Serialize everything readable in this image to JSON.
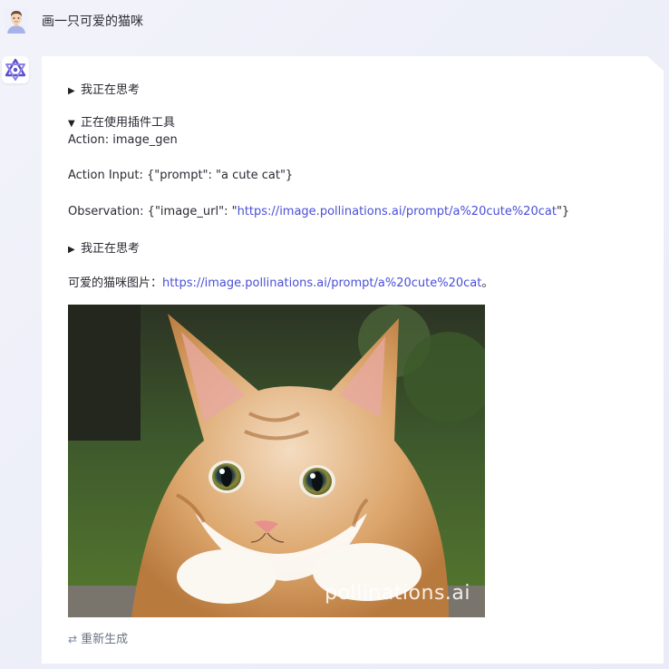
{
  "user": {
    "avatar_icon": "user-avatar-icon",
    "message": "画一只可爱的猫咪"
  },
  "bot": {
    "avatar_icon": "bot-logo-icon",
    "thinking_1": "我正在思考",
    "plugin_label": "正在使用插件工具",
    "action": "Action: image_gen",
    "action_input": "Action Input: {\"prompt\": \"a cute cat\"}",
    "observation_prefix": "Observation: {\"image_url\": \"",
    "observation_link": "https://image.pollinations.ai/prompt/a%20cute%20cat",
    "observation_suffix": "\"}",
    "thinking_2": "我正在思考",
    "answer_prefix": "可爱的猫咪图片：",
    "answer_link": "https://image.pollinations.ai/prompt/a%20cute%20cat",
    "answer_suffix": "。",
    "image_watermark": "pollinations.ai",
    "regenerate_label": "重新生成",
    "regenerate_icon": "refresh-icon"
  },
  "colors": {
    "link": "#4a4fd6",
    "bot_logo": "#5a4fcf",
    "background": "#eceef8"
  }
}
